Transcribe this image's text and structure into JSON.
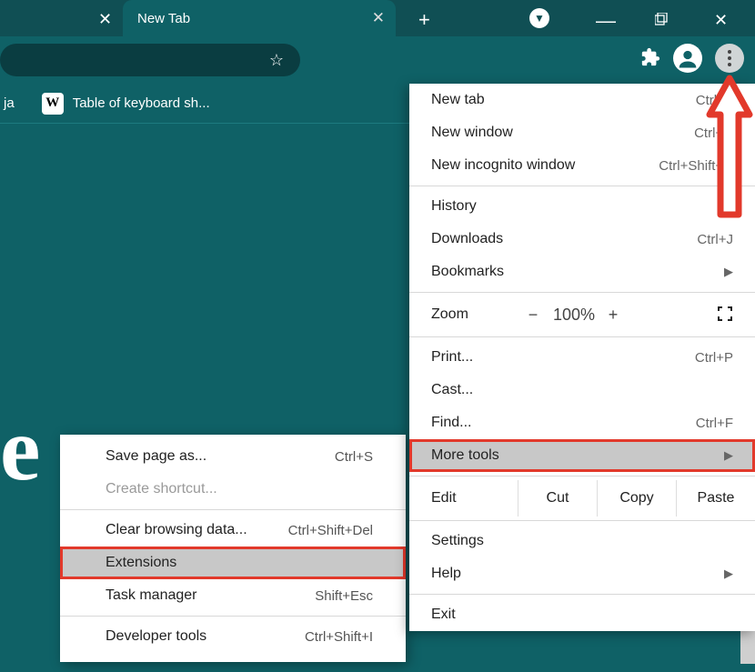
{
  "tabs": {
    "prev_close": "✕",
    "active_title": "New Tab",
    "active_close": "✕",
    "newtab": "+",
    "chevron": "▼"
  },
  "window": {
    "min": "—",
    "close": "✕"
  },
  "toolbar": {
    "star": "☆",
    "ext": "✦"
  },
  "bookmarks": {
    "partial": "ja",
    "w": "W",
    "tbl": "Table of keyboard sh..."
  },
  "content": {
    "e": "e"
  },
  "menu": {
    "newtab": {
      "label": "New tab",
      "shortcut": "Ctrl+T"
    },
    "newwin": {
      "label": "New window",
      "shortcut": "Ctrl+N"
    },
    "incog": {
      "label": "New incognito window",
      "shortcut": "Ctrl+Shift+N"
    },
    "history": {
      "label": "History",
      "arrow": "▶"
    },
    "downloads": {
      "label": "Downloads",
      "shortcut": "Ctrl+J"
    },
    "bookmarks": {
      "label": "Bookmarks",
      "arrow": "▶"
    },
    "zoom": {
      "label": "Zoom",
      "minus": "−",
      "value": "100%",
      "plus": "+"
    },
    "print": {
      "label": "Print...",
      "shortcut": "Ctrl+P"
    },
    "cast": {
      "label": "Cast..."
    },
    "find": {
      "label": "Find...",
      "shortcut": "Ctrl+F"
    },
    "moretools": {
      "label": "More tools",
      "arrow": "▶"
    },
    "edit": {
      "label": "Edit",
      "cut": "Cut",
      "copy": "Copy",
      "paste": "Paste"
    },
    "settings": {
      "label": "Settings"
    },
    "help": {
      "label": "Help",
      "arrow": "▶"
    },
    "exit": {
      "label": "Exit"
    }
  },
  "submenu": {
    "savepage": {
      "label": "Save page as...",
      "shortcut": "Ctrl+S"
    },
    "shortcut": {
      "label": "Create shortcut..."
    },
    "clear": {
      "label": "Clear browsing data...",
      "shortcut": "Ctrl+Shift+Del"
    },
    "extensions": {
      "label": "Extensions"
    },
    "taskmgr": {
      "label": "Task manager",
      "shortcut": "Shift+Esc"
    },
    "devtools": {
      "label": "Developer tools",
      "shortcut": "Ctrl+Shift+I"
    }
  }
}
